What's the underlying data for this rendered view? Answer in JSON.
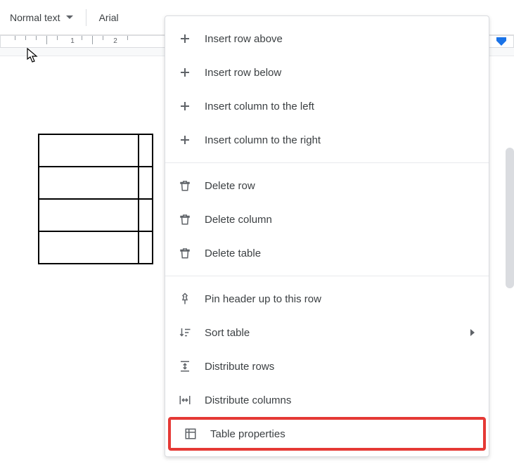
{
  "toolbar": {
    "style_label": "Normal text",
    "font_label": "Arial"
  },
  "ruler": {
    "marks": [
      "1",
      "2"
    ]
  },
  "context_menu": {
    "insert_row_above": "Insert row above",
    "insert_row_below": "Insert row below",
    "insert_col_left": "Insert column to the left",
    "insert_col_right": "Insert column to the right",
    "delete_row": "Delete row",
    "delete_column": "Delete column",
    "delete_table": "Delete table",
    "pin_header": "Pin header up to this row",
    "sort_table": "Sort table",
    "distribute_rows": "Distribute rows",
    "distribute_columns": "Distribute columns",
    "table_properties": "Table properties"
  }
}
